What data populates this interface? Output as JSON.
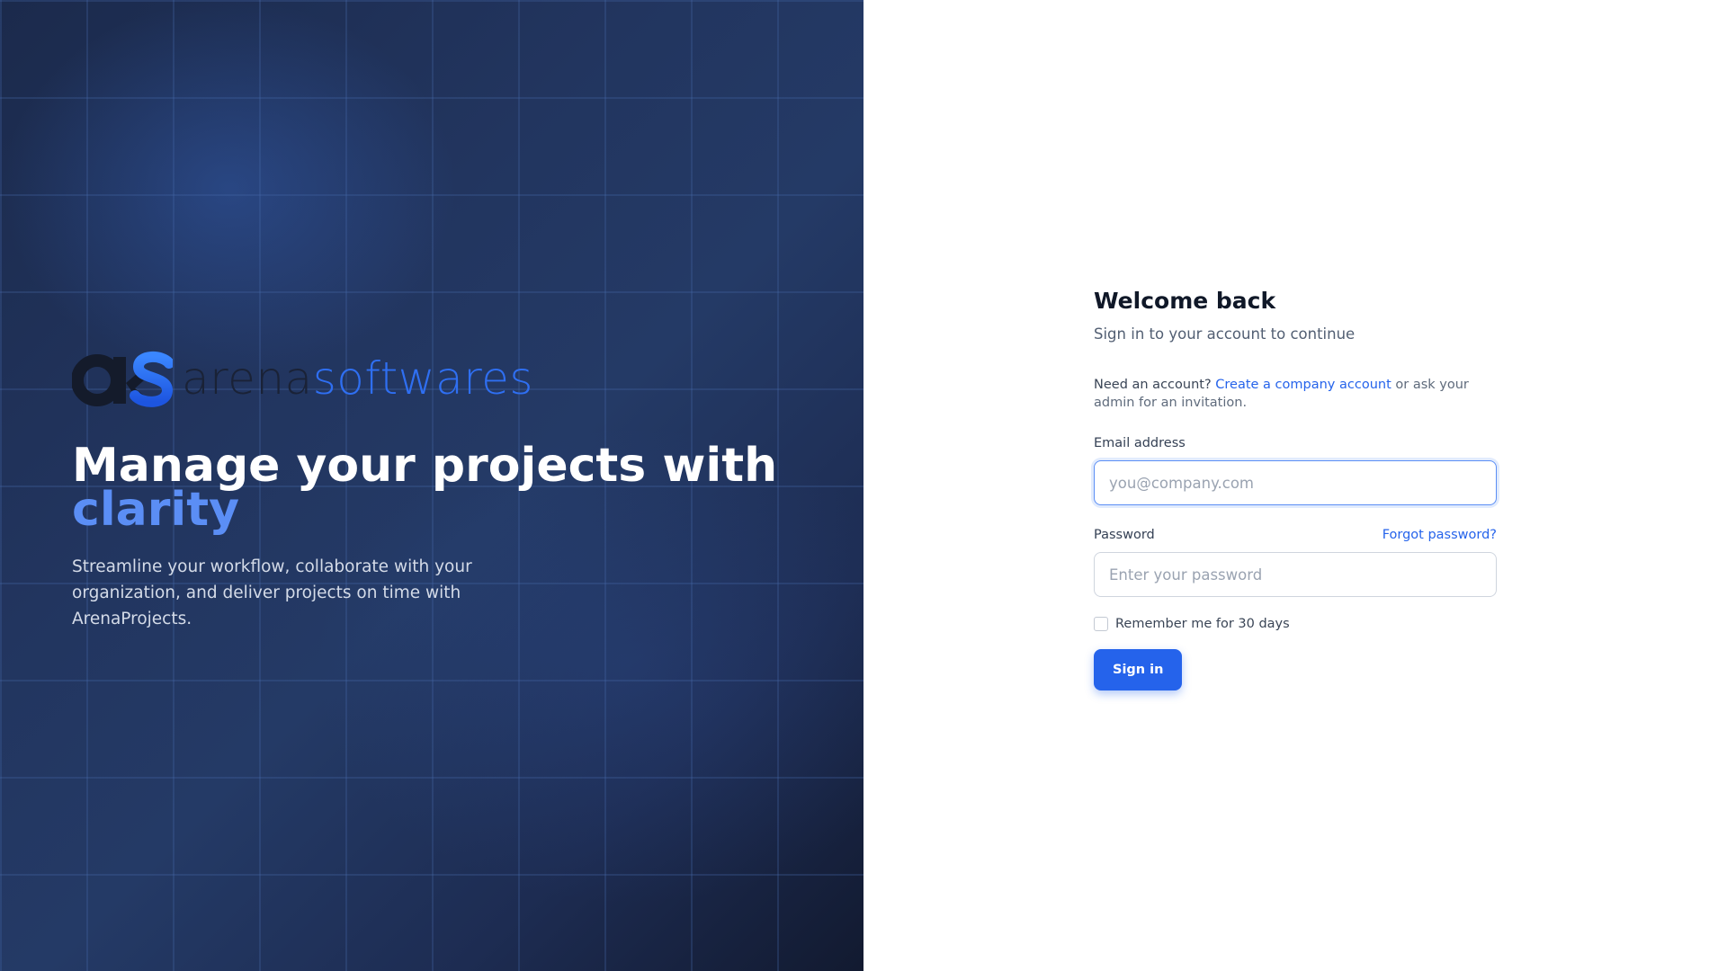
{
  "brand": {
    "logo_icon": "as-monogram-logo",
    "name_part1": "arena",
    "name_part2": "softwares"
  },
  "hero": {
    "headline": "Manage your projects with",
    "headline_accent": "clarity",
    "subtext": "Streamline your workflow, collaborate with your organization, and deliver projects on time with ArenaProjects."
  },
  "auth": {
    "title": "Welcome back",
    "subtitle": "Sign in to your account to continue",
    "invite_lead": "Need an account?",
    "invite_link": "Create a company account",
    "invite_tail": "or ask your admin for an invitation.",
    "email": {
      "label": "Email address",
      "placeholder": "you@company.com",
      "value": ""
    },
    "password": {
      "label": "Password",
      "placeholder": "Enter your password",
      "value": "",
      "forgot_link": "Forgot password?"
    },
    "remember": {
      "label": "Remember me for 30 days",
      "checked": false
    },
    "submit_label": "Sign in"
  },
  "colors": {
    "accent": "#2563eb",
    "headline_accent": "#5b8ef5",
    "hero_dark": "#1b2a4c"
  }
}
